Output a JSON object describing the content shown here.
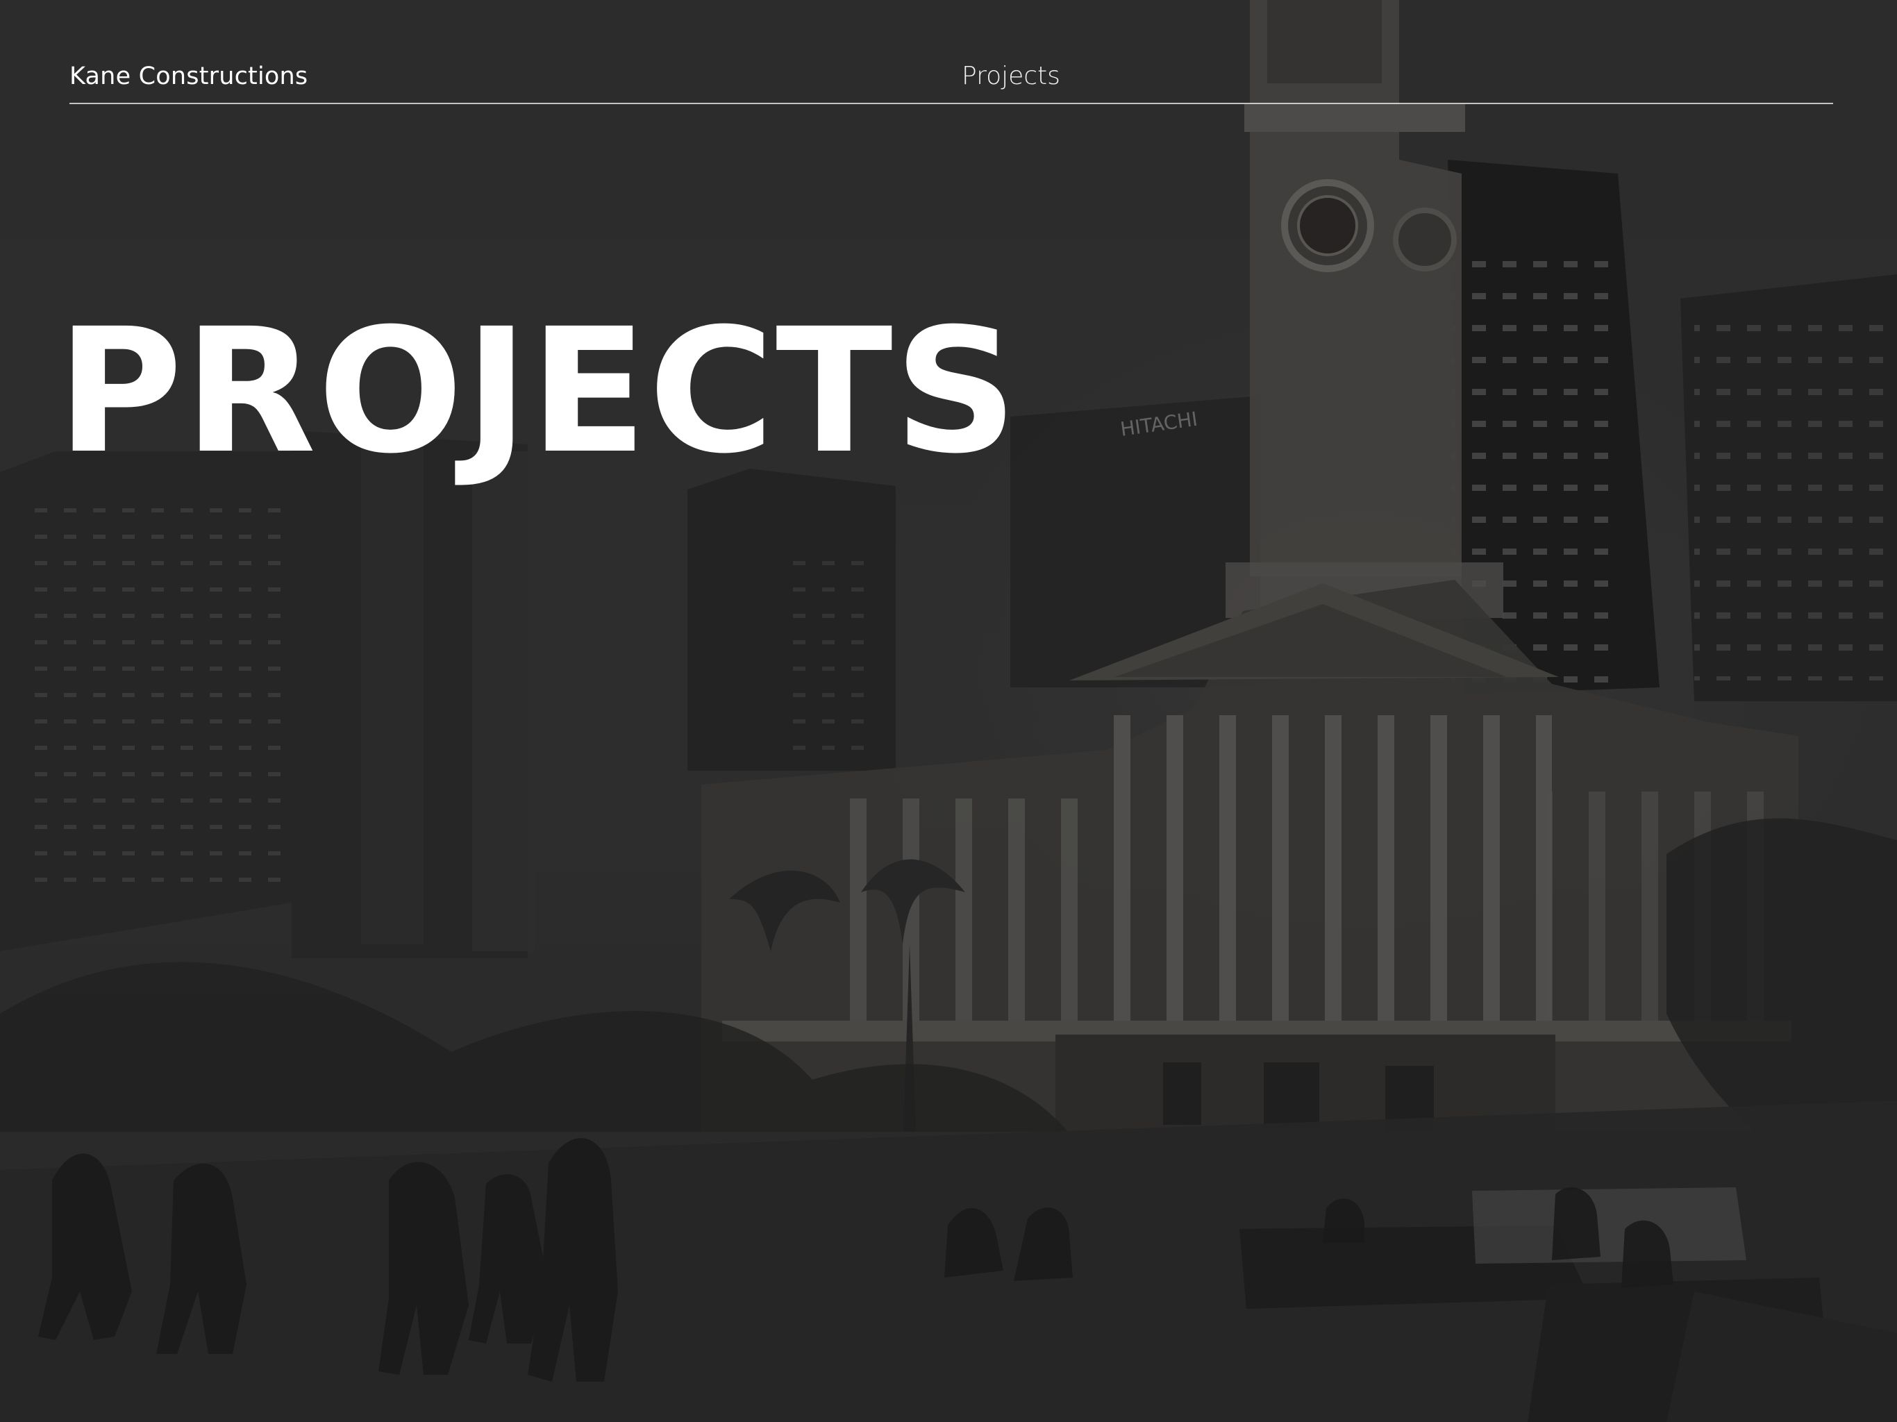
{
  "header": {
    "brand_label": "Kane Constructions",
    "nav_label": "Projects"
  },
  "hero": {
    "title": "PROJECTS",
    "photo_overlay_color": "#2b2b2c",
    "text_color": "#ffffff"
  }
}
